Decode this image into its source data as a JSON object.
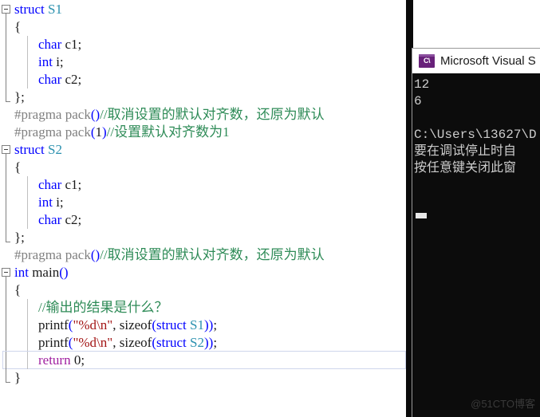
{
  "editor": {
    "name": "visual-studio-code-editor",
    "background": "#ffffff",
    "current_line_index": 20,
    "lines": [
      {
        "indent": 0,
        "fold": "open-start",
        "tokens": [
          {
            "c": "t-kw",
            "t": "struct"
          },
          {
            "c": "t-plain",
            "t": " "
          },
          {
            "c": "t-type",
            "t": "S1"
          }
        ]
      },
      {
        "indent": 0,
        "fold": "bar",
        "tokens": [
          {
            "c": "t-punct",
            "t": "{"
          }
        ]
      },
      {
        "indent": 1,
        "fold": "bar",
        "tokens": [
          {
            "c": "t-kw",
            "t": "char"
          },
          {
            "c": "t-plain",
            "t": " c1;"
          }
        ]
      },
      {
        "indent": 1,
        "fold": "bar",
        "tokens": [
          {
            "c": "t-kw",
            "t": "int"
          },
          {
            "c": "t-plain",
            "t": " i;"
          }
        ]
      },
      {
        "indent": 1,
        "fold": "bar",
        "tokens": [
          {
            "c": "t-kw",
            "t": "char"
          },
          {
            "c": "t-plain",
            "t": " c2;"
          }
        ]
      },
      {
        "indent": 0,
        "fold": "open-end",
        "tokens": [
          {
            "c": "t-punct",
            "t": "};"
          }
        ]
      },
      {
        "indent": 0,
        "fold": "none",
        "tokens": [
          {
            "c": "t-pre",
            "t": "#pragma pack"
          },
          {
            "c": "t-paren",
            "t": "()"
          },
          {
            "c": "t-cmt",
            "t": "//取消设置的默认对齐数，还原为默认"
          }
        ]
      },
      {
        "indent": 0,
        "fold": "none",
        "tokens": [
          {
            "c": "t-pre",
            "t": "#pragma pack"
          },
          {
            "c": "t-paren",
            "t": "("
          },
          {
            "c": "t-num",
            "t": "1"
          },
          {
            "c": "t-paren",
            "t": ")"
          },
          {
            "c": "t-cmt",
            "t": "//设置默认对齐数为1"
          }
        ]
      },
      {
        "indent": 0,
        "fold": "open-start",
        "tokens": [
          {
            "c": "t-kw",
            "t": "struct"
          },
          {
            "c": "t-plain",
            "t": " "
          },
          {
            "c": "t-type",
            "t": "S2"
          }
        ]
      },
      {
        "indent": 0,
        "fold": "bar",
        "tokens": [
          {
            "c": "t-punct",
            "t": "{"
          }
        ]
      },
      {
        "indent": 1,
        "fold": "bar",
        "tokens": [
          {
            "c": "t-kw",
            "t": "char"
          },
          {
            "c": "t-plain",
            "t": " c1;"
          }
        ]
      },
      {
        "indent": 1,
        "fold": "bar",
        "tokens": [
          {
            "c": "t-kw",
            "t": "int"
          },
          {
            "c": "t-plain",
            "t": " i;"
          }
        ]
      },
      {
        "indent": 1,
        "fold": "bar",
        "tokens": [
          {
            "c": "t-kw",
            "t": "char"
          },
          {
            "c": "t-plain",
            "t": " c2;"
          }
        ]
      },
      {
        "indent": 0,
        "fold": "open-end",
        "tokens": [
          {
            "c": "t-punct",
            "t": "};"
          }
        ]
      },
      {
        "indent": 0,
        "fold": "none",
        "tokens": [
          {
            "c": "t-pre",
            "t": "#pragma pack"
          },
          {
            "c": "t-paren",
            "t": "()"
          },
          {
            "c": "t-cmt",
            "t": "//取消设置的默认对齐数，还原为默认"
          }
        ]
      },
      {
        "indent": 0,
        "fold": "open-start",
        "tokens": [
          {
            "c": "t-kw",
            "t": "int"
          },
          {
            "c": "t-plain",
            "t": " main"
          },
          {
            "c": "t-paren",
            "t": "()"
          }
        ]
      },
      {
        "indent": 0,
        "fold": "bar",
        "tokens": [
          {
            "c": "t-punct",
            "t": "{"
          }
        ]
      },
      {
        "indent": 1,
        "fold": "bar",
        "tokens": [
          {
            "c": "t-cmt",
            "t": "//输出的结果是什么？"
          }
        ]
      },
      {
        "indent": 1,
        "fold": "bar",
        "tokens": [
          {
            "c": "t-plain",
            "t": "printf"
          },
          {
            "c": "t-paren",
            "t": "("
          },
          {
            "c": "t-str",
            "t": "\"%d"
          },
          {
            "c": "t-esc",
            "t": "\\n"
          },
          {
            "c": "t-str",
            "t": "\""
          },
          {
            "c": "t-plain",
            "t": ", "
          },
          {
            "c": "t-plain",
            "t": "sizeof"
          },
          {
            "c": "t-paren",
            "t": "("
          },
          {
            "c": "t-kw",
            "t": "struct"
          },
          {
            "c": "t-plain",
            "t": " "
          },
          {
            "c": "t-type",
            "t": "S1"
          },
          {
            "c": "t-paren",
            "t": "))"
          },
          {
            "c": "t-punct",
            "t": ";"
          }
        ]
      },
      {
        "indent": 1,
        "fold": "bar",
        "tokens": [
          {
            "c": "t-plain",
            "t": "printf"
          },
          {
            "c": "t-paren",
            "t": "("
          },
          {
            "c": "t-str",
            "t": "\"%d"
          },
          {
            "c": "t-esc",
            "t": "\\n"
          },
          {
            "c": "t-str",
            "t": "\""
          },
          {
            "c": "t-plain",
            "t": ", "
          },
          {
            "c": "t-plain",
            "t": "sizeof"
          },
          {
            "c": "t-paren",
            "t": "("
          },
          {
            "c": "t-kw",
            "t": "struct"
          },
          {
            "c": "t-plain",
            "t": " "
          },
          {
            "c": "t-type",
            "t": "S2"
          },
          {
            "c": "t-paren",
            "t": "))"
          },
          {
            "c": "t-punct",
            "t": ";"
          }
        ]
      },
      {
        "indent": 1,
        "fold": "bar",
        "tokens": [
          {
            "c": "t-ctl",
            "t": "return"
          },
          {
            "c": "t-plain",
            "t": " "
          },
          {
            "c": "t-num",
            "t": "0"
          },
          {
            "c": "t-punct",
            "t": ";"
          }
        ]
      },
      {
        "indent": 0,
        "fold": "open-end",
        "tokens": [
          {
            "c": "t-punct",
            "t": "}"
          }
        ]
      }
    ],
    "colors": {
      "keyword": "#0000ff",
      "type": "#2b91af",
      "string": "#a31515",
      "comment": "#2e8b57",
      "preprocessor": "#808080",
      "control": "#a020a0",
      "plain": "#1a1a1a"
    }
  },
  "console": {
    "title": "Microsoft Visual S",
    "icon": "visual-studio-console-icon",
    "accent_color": "#68217a",
    "background": "#0c0c0c",
    "text_color": "#cccccc",
    "lines": [
      "12",
      "6",
      "",
      "C:\\Users\\13627\\D",
      "要在调试停止时自",
      "按任意键关闭此窗"
    ]
  },
  "watermark": {
    "text": "@51CTO博客"
  }
}
